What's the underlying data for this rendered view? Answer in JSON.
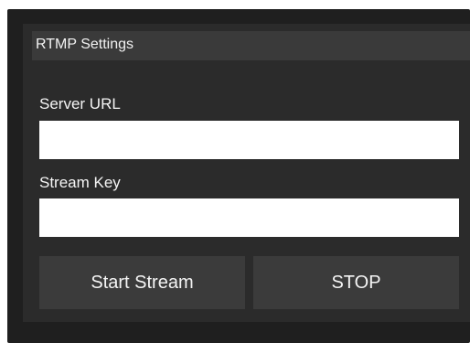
{
  "panel": {
    "title": "RTMP Settings"
  },
  "server_url": {
    "label": "Server URL",
    "value": "",
    "placeholder": ""
  },
  "stream_key": {
    "label": "Stream Key",
    "value": "",
    "placeholder": ""
  },
  "buttons": {
    "start_label": "Start Stream",
    "stop_label": "STOP"
  },
  "colors": {
    "outer_background": "#1f1f1f",
    "panel_background": "#2b2b2b",
    "header_background": "#3a3a3a",
    "button_background": "#3b3b3b",
    "text": "#f5f5f5",
    "input_background": "#ffffff"
  }
}
